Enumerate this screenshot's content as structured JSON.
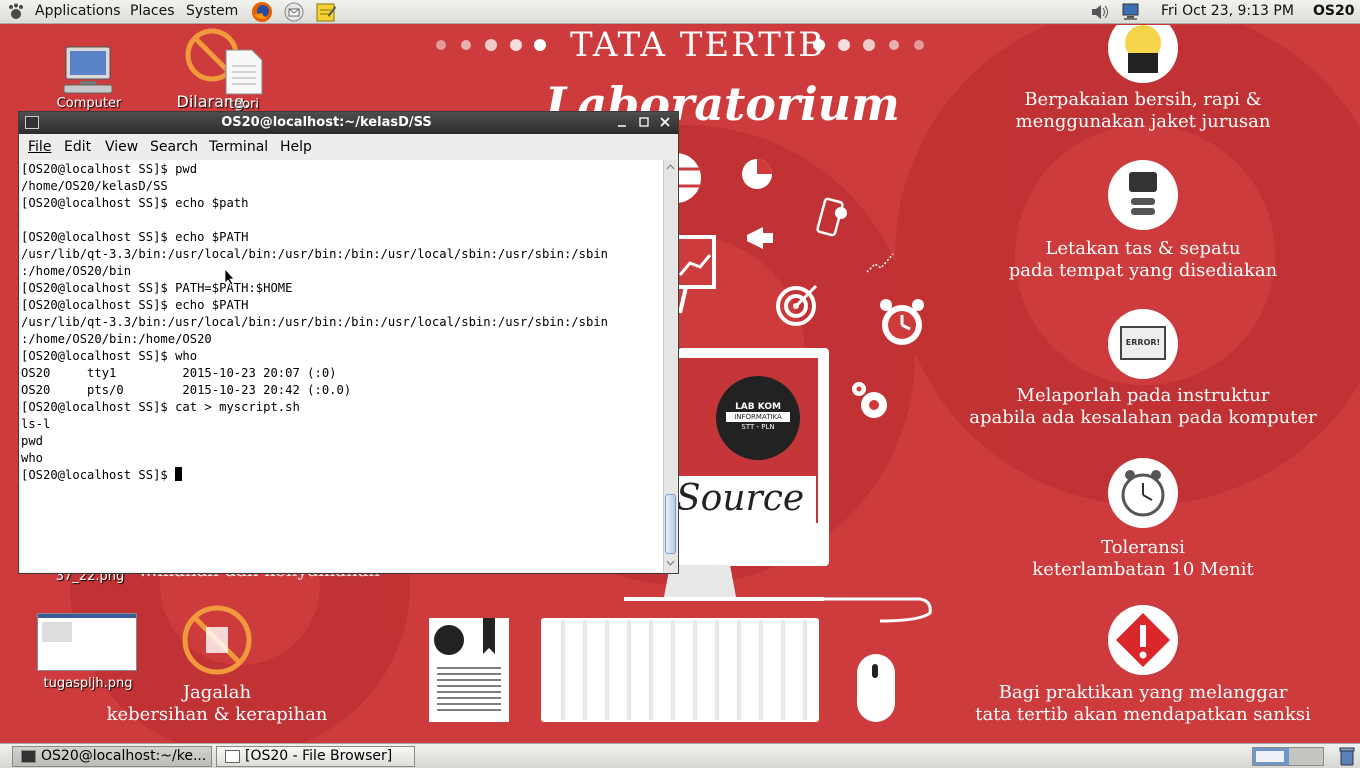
{
  "top_panel": {
    "menus": [
      "Applications",
      "Places",
      "System"
    ],
    "clock": "Fri Oct 23,  9:13 PM",
    "user": "OS20"
  },
  "desktop_icons": [
    {
      "label": "Computer"
    },
    {
      "label": "Dilarang..."
    },
    {
      "label": "teori"
    },
    {
      "label": "37_22.png"
    },
    {
      "label": "tugasplјh.png"
    }
  ],
  "wallpaper": {
    "header": "TATA TERTIB",
    "subheader": "Laboratorium",
    "monitor_text": "Source",
    "logo_line1": "LAB KOM",
    "logo_line2": "INFORMATIKA",
    "logo_line3": "STT - PLN",
    "error_label": "ERROR!",
    "rules": [
      {
        "line1": "Berpakaian bersih, rapi &",
        "line2": "menggunakan jaket jurusan"
      },
      {
        "line1": "Letakan tas & sepatu",
        "line2": "pada tempat yang disediakan"
      },
      {
        "line1": "Melaporlah pada instruktur",
        "line2": "apabila ada kesalahan pada komputer"
      },
      {
        "line1": "Toleransi",
        "line2": "keterlambatan 10 Menit"
      },
      {
        "line1": "Bagi praktikan yang melanggar",
        "line2": "tata tertib akan mendapatkan sanksi"
      }
    ],
    "left_rule": {
      "line1": "Jagalah",
      "line2": "kebersihan & kerapihan"
    },
    "partial_text": "...mahan dan kenyamanan"
  },
  "terminal": {
    "title": "OS20@localhost:~/kelasD/SS",
    "menu": [
      "File",
      "Edit",
      "View",
      "Search",
      "Terminal",
      "Help"
    ],
    "lines": [
      "[OS20@localhost SS]$ pwd",
      "/home/OS20/kelasD/SS",
      "[OS20@localhost SS]$ echo $path",
      "",
      "[OS20@localhost SS]$ echo $PATH",
      "/usr/lib/qt-3.3/bin:/usr/local/bin:/usr/bin:/bin:/usr/local/sbin:/usr/sbin:/sbin",
      ":/home/OS20/bin",
      "[OS20@localhost SS]$ PATH=$PATH:$HOME",
      "[OS20@localhost SS]$ echo $PATH",
      "/usr/lib/qt-3.3/bin:/usr/local/bin:/usr/bin:/bin:/usr/local/sbin:/usr/sbin:/sbin",
      ":/home/OS20/bin:/home/OS20",
      "[OS20@localhost SS]$ who",
      "OS20     tty1         2015-10-23 20:07 (:0)",
      "OS20     pts/0        2015-10-23 20:42 (:0.0)",
      "[OS20@localhost SS]$ cat > myscript.sh",
      "ls-l",
      "pwd",
      "who",
      "[OS20@localhost SS]$ "
    ]
  },
  "taskbar": {
    "items": [
      "OS20@localhost:~/ke...",
      "[OS20 - File Browser]"
    ]
  }
}
